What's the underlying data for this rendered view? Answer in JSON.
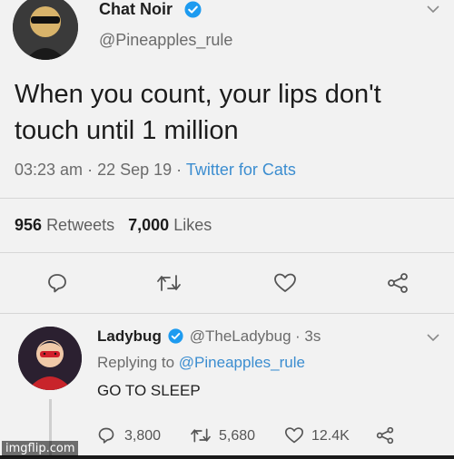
{
  "main_tweet": {
    "author_name": "Chat Noir",
    "handle": "@Pineapples_rule",
    "text_line1": "When you count, your lips don't",
    "text_line2": "touch until 1 million",
    "time": "03:23 am",
    "date": "22 Sep 19",
    "source": "Twitter for Cats",
    "retweets_count": "956",
    "retweets_label": "Retweets",
    "likes_count": "7,000",
    "likes_label": "Likes",
    "actions": [
      "reply-icon",
      "retweet-icon",
      "like-icon",
      "share-icon"
    ]
  },
  "reply": {
    "author_name": "Ladybug",
    "handle": "@TheLadybug",
    "age": "3s",
    "replying_prefix": "Replying to",
    "replying_handle": "@Pineapples_rule",
    "text": "GO TO SLEEP",
    "reply_count": "3,800",
    "retweet_count": "5,680",
    "like_count": "12.4K"
  },
  "colors": {
    "background": "#f2f2f2",
    "link": "#3b8dd0",
    "verified": "#1d9bf0",
    "muted": "#6b6b6b"
  },
  "watermark": "imgflip.com"
}
